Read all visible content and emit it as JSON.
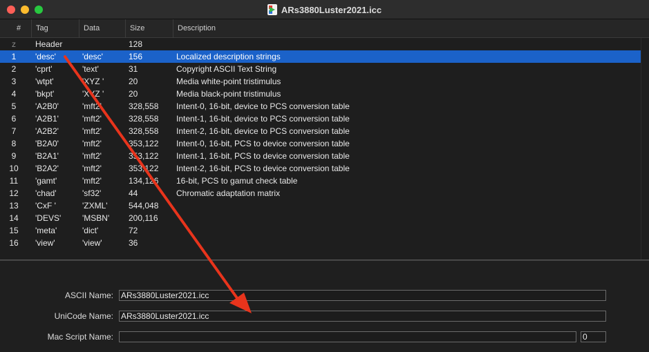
{
  "window": {
    "title": "ARs3880Luster2021.icc"
  },
  "columns": [
    "#",
    "Tag",
    "Data",
    "Size",
    "Description"
  ],
  "rows": [
    {
      "num": "z",
      "tag": "Header",
      "data": "",
      "size": "128",
      "desc": ""
    },
    {
      "num": "1",
      "tag": "'desc'",
      "data": "'desc'",
      "size": "156",
      "desc": "Localized description strings"
    },
    {
      "num": "2",
      "tag": "'cprt'",
      "data": "'text'",
      "size": "31",
      "desc": "Copyright ASCII Text String"
    },
    {
      "num": "3",
      "tag": "'wtpt'",
      "data": "'XYZ '",
      "size": "20",
      "desc": "Media white-point tristimulus"
    },
    {
      "num": "4",
      "tag": "'bkpt'",
      "data": "'XYZ '",
      "size": "20",
      "desc": "Media black-point tristimulus"
    },
    {
      "num": "5",
      "tag": "'A2B0'",
      "data": "'mft2'",
      "size": "328,558",
      "desc": "Intent-0, 16-bit, device to PCS conversion table"
    },
    {
      "num": "6",
      "tag": "'A2B1'",
      "data": "'mft2'",
      "size": "328,558",
      "desc": "Intent-1, 16-bit, device to PCS conversion table"
    },
    {
      "num": "7",
      "tag": "'A2B2'",
      "data": "'mft2'",
      "size": "328,558",
      "desc": "Intent-2, 16-bit, device to PCS conversion table"
    },
    {
      "num": "8",
      "tag": "'B2A0'",
      "data": "'mft2'",
      "size": "353,122",
      "desc": "Intent-0, 16-bit, PCS to device conversion table"
    },
    {
      "num": "9",
      "tag": "'B2A1'",
      "data": "'mft2'",
      "size": "353,122",
      "desc": "Intent-1, 16-bit, PCS to device conversion table"
    },
    {
      "num": "10",
      "tag": "'B2A2'",
      "data": "'mft2'",
      "size": "353,122",
      "desc": "Intent-2, 16-bit, PCS to device conversion table"
    },
    {
      "num": "11",
      "tag": "'gamt'",
      "data": "'mft2'",
      "size": "134,126",
      "desc": "16-bit, PCS to gamut check table"
    },
    {
      "num": "12",
      "tag": "'chad'",
      "data": "'sf32'",
      "size": "44",
      "desc": "Chromatic adaptation matrix"
    },
    {
      "num": "13",
      "tag": "'CxF '",
      "data": "'ZXML'",
      "size": "544,048",
      "desc": ""
    },
    {
      "num": "14",
      "tag": "'DEVS'",
      "data": "'MSBN'",
      "size": "200,116",
      "desc": ""
    },
    {
      "num": "15",
      "tag": "'meta'",
      "data": "'dict'",
      "size": "72",
      "desc": ""
    },
    {
      "num": "16",
      "tag": "'view'",
      "data": "'view'",
      "size": "36",
      "desc": ""
    }
  ],
  "selected_row": 1,
  "details": {
    "ascii_label": "ASCII Name:",
    "ascii_value": "ARs3880Luster2021.icc",
    "unicode_label": "UniCode Name:",
    "unicode_value": "ARs3880Luster2021.icc",
    "macscript_label": "Mac Script Name:",
    "macscript_value": "",
    "macscript_code": "0"
  },
  "colors": {
    "selection": "#1b62c9",
    "arrow": "#e8341c"
  }
}
